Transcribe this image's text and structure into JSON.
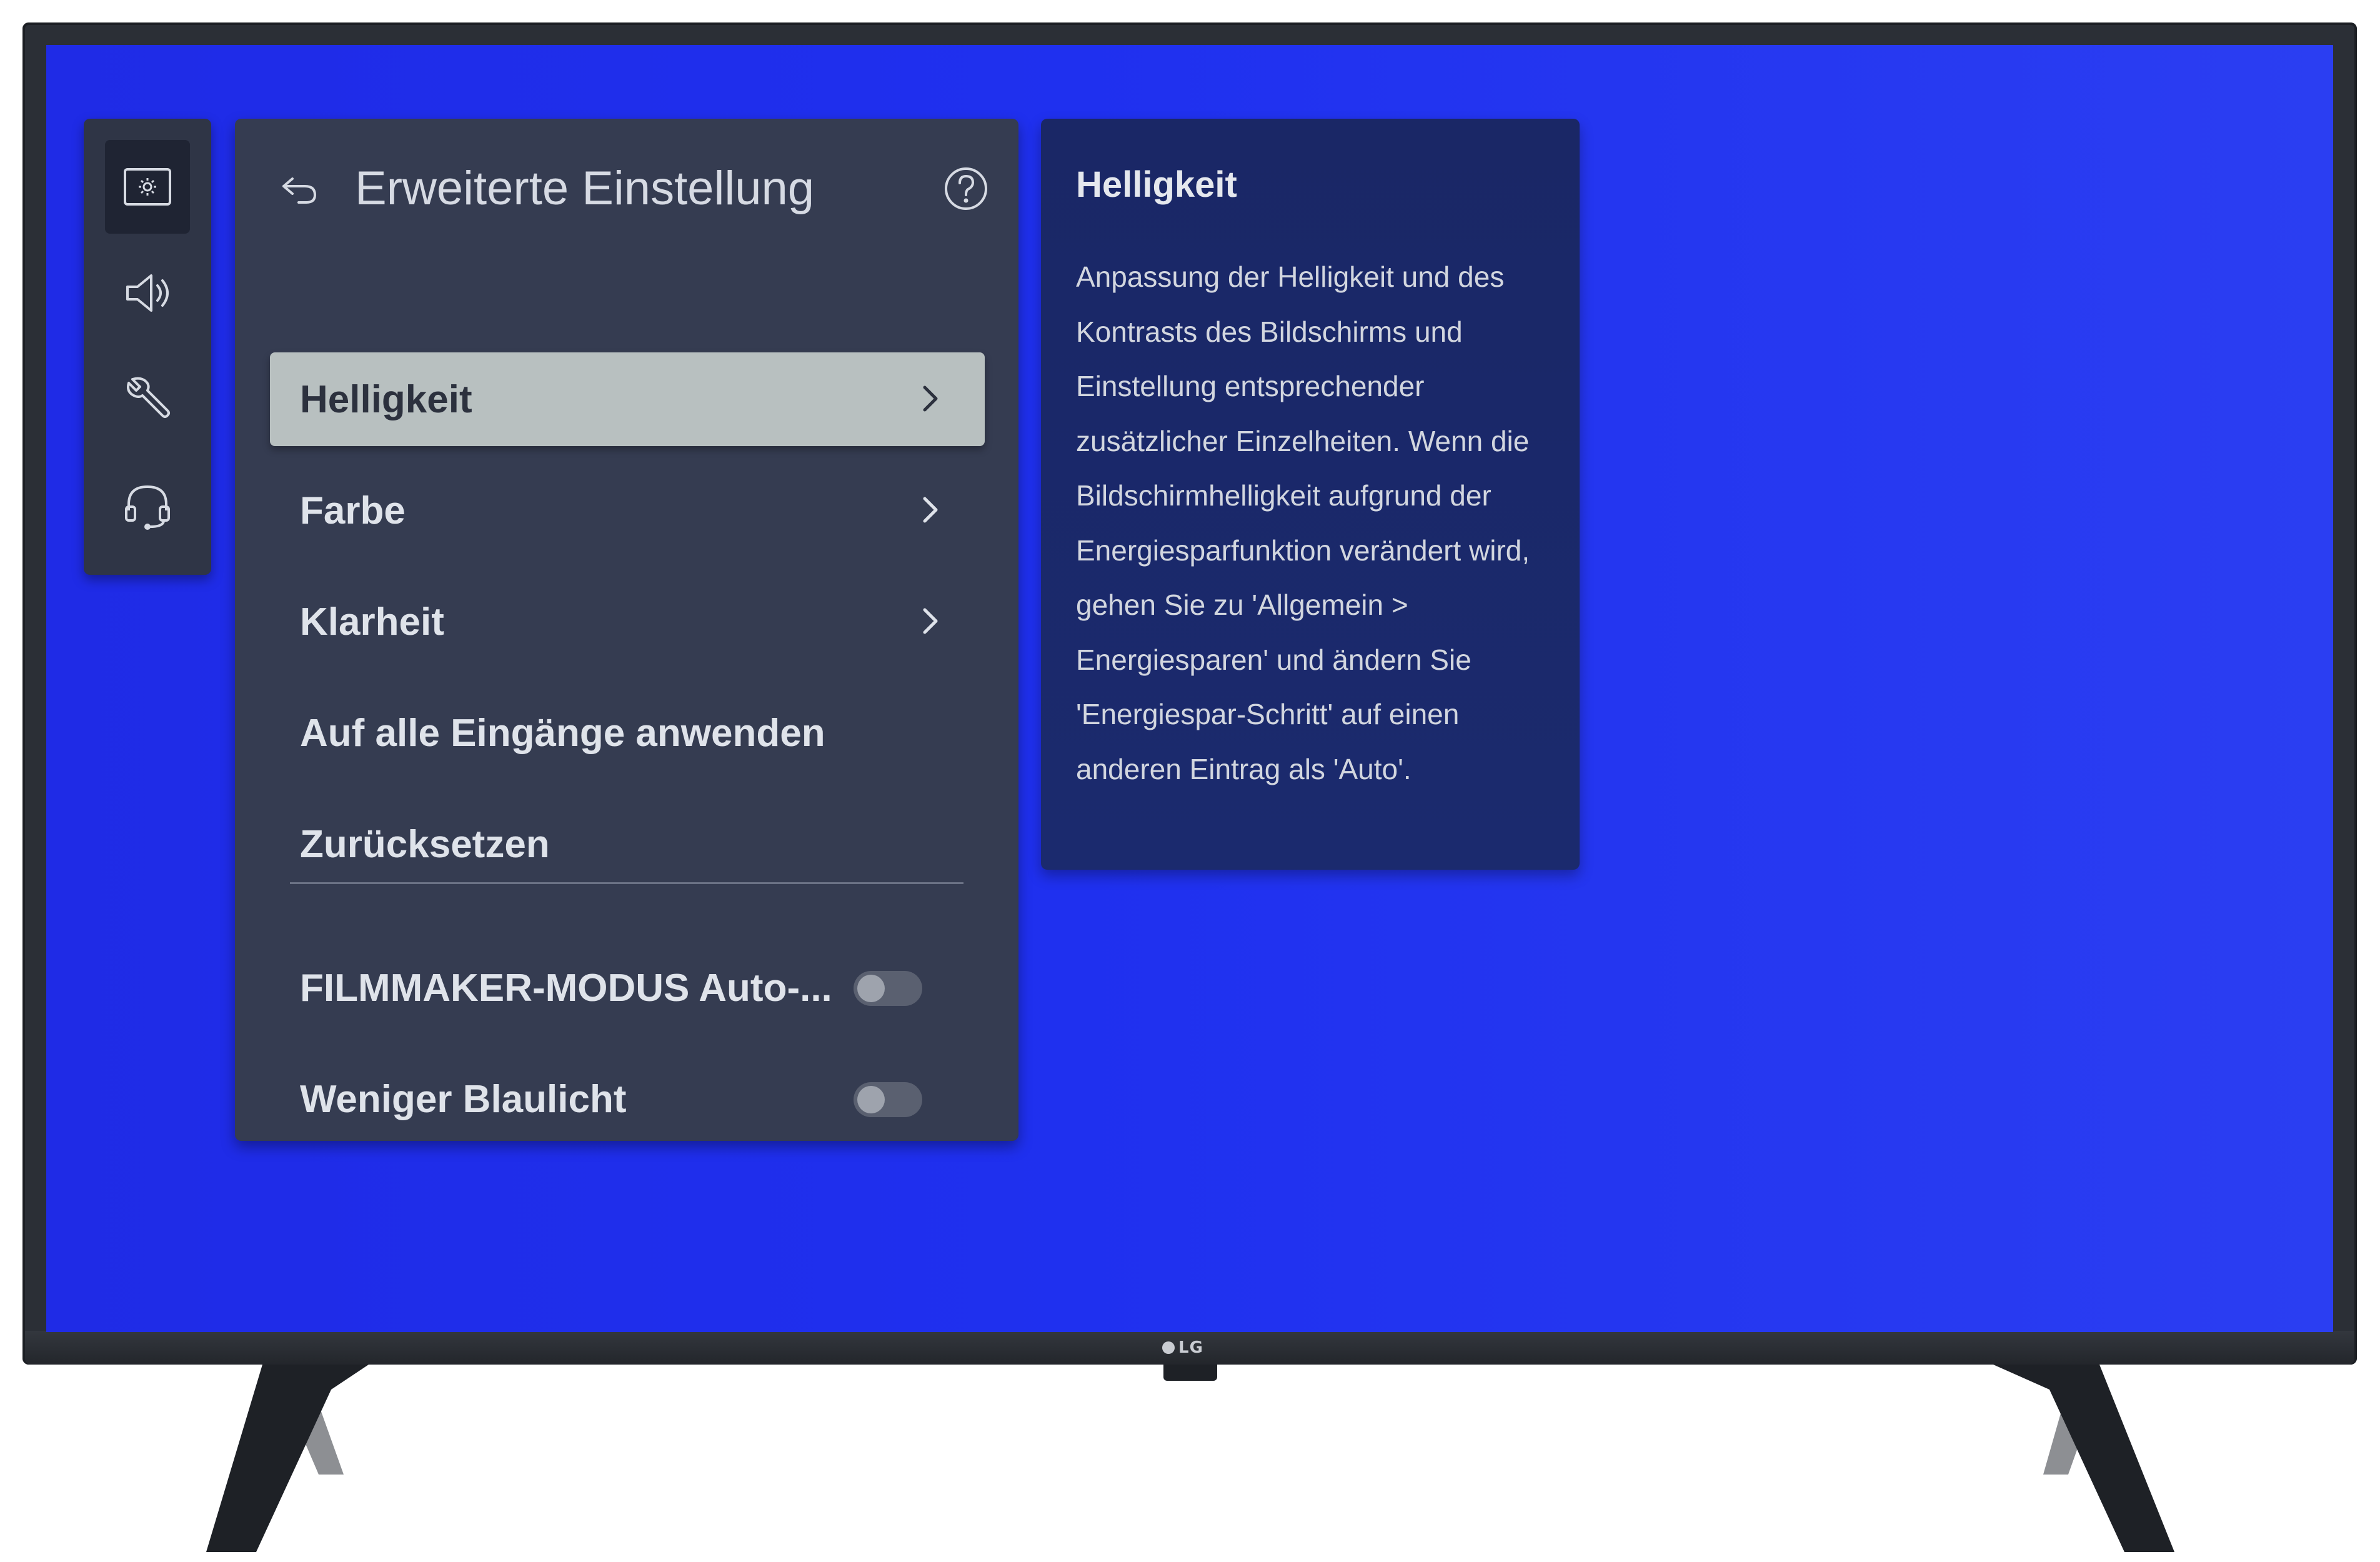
{
  "panel": {
    "title": "Erweiterte Einstellung",
    "items": [
      {
        "label": "Helligkeit",
        "chevron": true,
        "selected": true
      },
      {
        "label": "Farbe",
        "chevron": true
      },
      {
        "label": "Klarheit",
        "chevron": true
      },
      {
        "label": "Auf alle Eingänge anwenden"
      },
      {
        "label": "Zurücksetzen"
      }
    ],
    "toggles": [
      {
        "label": "FILMMAKER-MODUS Auto-...",
        "state": "off"
      },
      {
        "label": "Weniger Blaulicht",
        "state": "off"
      }
    ]
  },
  "side_nav": {
    "icons": [
      "picture-icon",
      "speaker-icon",
      "wrench-icon",
      "headset-icon"
    ],
    "active": "picture-icon"
  },
  "info": {
    "title": "Helligkeit",
    "body": "Anpassung der Helligkeit und des Kontrasts des Bildschirms und Einstellung entsprechender zusätzlicher Einzelheiten. Wenn die Bildschirmhelligkeit aufgrund der Energiesparfunktion verändert wird, gehen Sie zu 'Allgemein > Energiesparen' und ändern Sie 'Energiespar-Schritt' auf einen anderen Eintrag als 'Auto'."
  },
  "brand": {
    "logo_text": "LG"
  },
  "colors": {
    "screen": "#1f30ef",
    "panel": "#353c51",
    "selected": "#b8c0c0",
    "info": "#1b2a6e"
  }
}
